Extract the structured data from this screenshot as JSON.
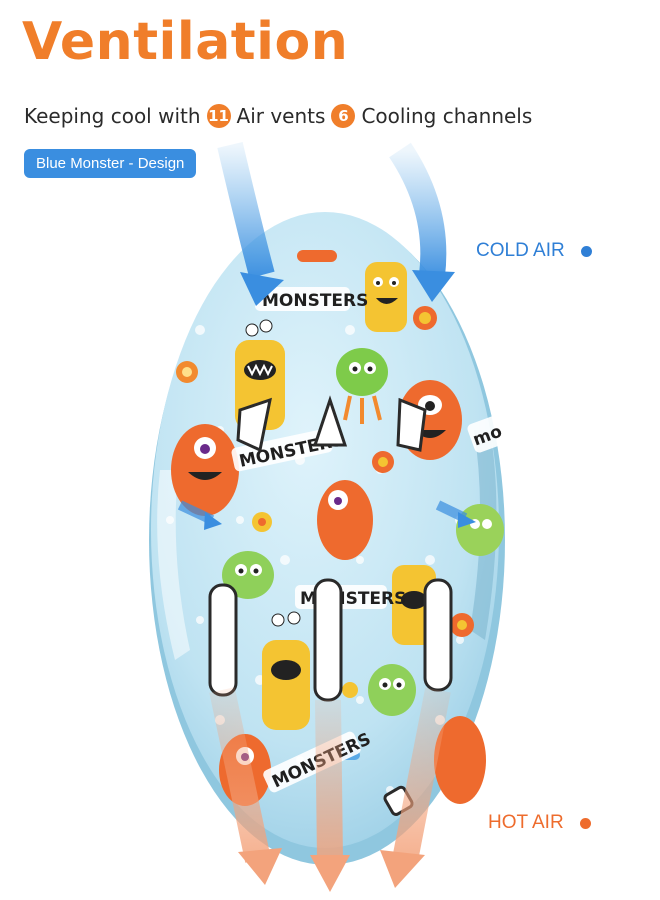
{
  "header": {
    "title": "Ventilation",
    "subtitle_prefix": "Keeping cool with",
    "air_vents_count": "11",
    "air_vents_label": "Air vents",
    "cooling_channels_count": "6",
    "cooling_channels_label": "Cooling channels"
  },
  "design_tag": "Blue Monster - Design",
  "labels": {
    "cold_air": "COLD AIR",
    "hot_air": "HOT AIR"
  },
  "helmet": {
    "print_text": "MONSTERS",
    "colors": {
      "shell": "#bfe3f2",
      "cold_arrow": "#5aa9e6",
      "hot_arrow": "#f3a37c",
      "accent": "#f07e2a"
    }
  }
}
